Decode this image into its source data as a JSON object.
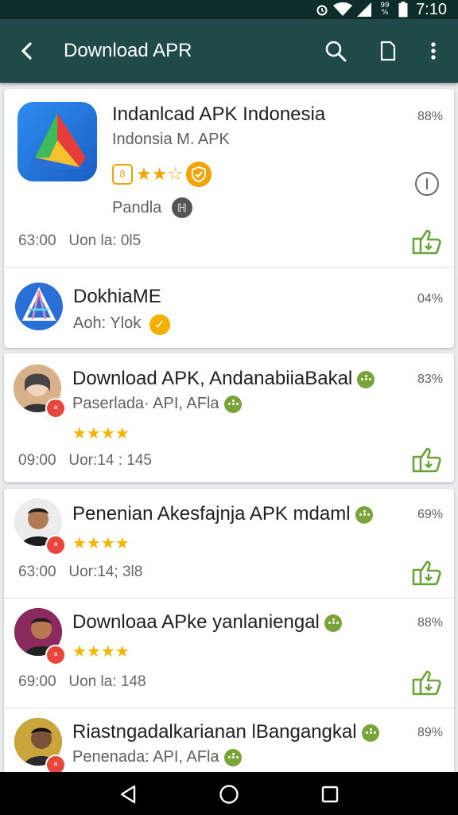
{
  "status_bar": {
    "signal_pct": "99",
    "signal_pct2": "%",
    "time": "7:10"
  },
  "app_bar": {
    "title": "Download APR"
  },
  "cards": {
    "c1": {
      "title": "Indanlcad APK Indonesia",
      "subtitle": "Indonsia M. APK",
      "developer": "Pandla",
      "percent": "88%",
      "time": "63:00",
      "version": "Uon la: 0l5",
      "rating_icons": "★★☆"
    },
    "c2": {
      "title": "DokhiaME",
      "subtitle": "Aoh: Ylok",
      "percent": "04%"
    },
    "c3": {
      "title": "Download APK, AndanabiiaBakal",
      "subtitle": "Paserlada· API, AFla",
      "percent": "83%",
      "stars": "★★★★",
      "time": "09:00",
      "version": "Uor:14 : 145"
    },
    "c4": {
      "title": "Penenian Akesfajnja APK mdaml",
      "percent": "69%",
      "stars": "★★★★",
      "time": "63:00",
      "version": "Uor:14; 3l8"
    },
    "c5": {
      "title": "Downloaa APke yanlaniengal",
      "percent": "88%",
      "stars": "★★★★",
      "time": "69:00",
      "version": "Uon la: 148"
    },
    "c6": {
      "title": "Riastngadalkarianan lBangangkal",
      "subtitle": "Penenada: API, AFla",
      "percent": "89%"
    }
  },
  "icons": {
    "back": "arrow-left-icon",
    "search": "search-icon",
    "doc": "document-icon",
    "more": "more-vert-icon",
    "wifi": "wifi-icon",
    "signal": "signal-icon",
    "battery": "battery-icon",
    "alarm": "alarm-icon",
    "info": "info-icon",
    "download": "download-icon",
    "verified": "verified-icon",
    "nav_back": "nav-back-icon",
    "nav_home": "nav-home-icon",
    "nav_recent": "nav-recent-icon"
  },
  "colors": {
    "app_bar": "#1f4a48",
    "status_bar": "#0e2c2a",
    "accent_green": "#7aa33a",
    "star": "#f4b400",
    "badge": "#e8453c"
  }
}
